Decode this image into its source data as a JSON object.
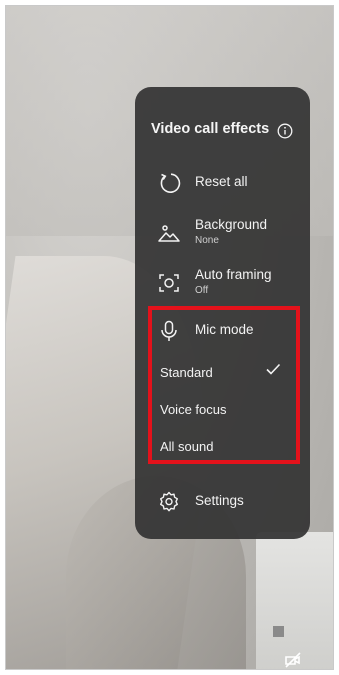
{
  "panel": {
    "title": "Video call effects",
    "items": {
      "reset": {
        "label": "Reset all"
      },
      "background": {
        "label": "Background",
        "value": "None"
      },
      "auto_framing": {
        "label": "Auto framing",
        "value": "Off"
      },
      "mic_mode": {
        "label": "Mic mode"
      },
      "settings": {
        "label": "Settings"
      }
    },
    "mic_options": [
      {
        "label": "Standard",
        "selected": true
      },
      {
        "label": "Voice focus",
        "selected": false
      },
      {
        "label": "All sound",
        "selected": false
      }
    ]
  },
  "colors": {
    "panel_bg": "#343434",
    "highlight_border": "#e4121b",
    "text": "#f3f3f3"
  },
  "icons": {
    "info": "info-icon",
    "reset": "reset-icon",
    "background": "image-icon",
    "auto_framing": "auto-framing-icon",
    "mic": "microphone-icon",
    "check": "checkmark-icon",
    "settings": "gear-icon",
    "camera_off": "camera-off-icon"
  }
}
